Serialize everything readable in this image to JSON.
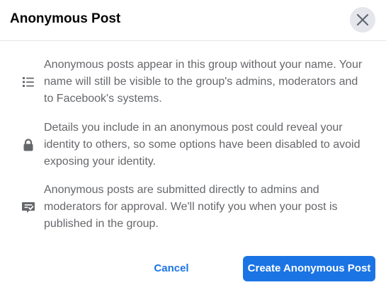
{
  "dialog": {
    "title": "Anonymous Post",
    "close_icon": "close-icon"
  },
  "items": [
    {
      "icon": "list-icon",
      "text": "Anonymous posts appear in this group without your name. Your name will still be visible to the group's admins, moderators and to Facebook's systems."
    },
    {
      "icon": "lock-icon",
      "text": "Details you include in an anonymous post could reveal your identity to others, so some options have been disabled to avoid exposing your identity."
    },
    {
      "icon": "approval-icon",
      "text": "Anonymous posts are submitted directly to admins and moderators for approval. We'll notify you when your post is published in the group."
    }
  ],
  "footer": {
    "cancel_label": "Cancel",
    "create_label": "Create Anonymous Post"
  },
  "colors": {
    "accent": "#1b74e4",
    "text_secondary": "#65676b",
    "text_primary": "#050505",
    "close_bg": "#e4e6eb"
  }
}
